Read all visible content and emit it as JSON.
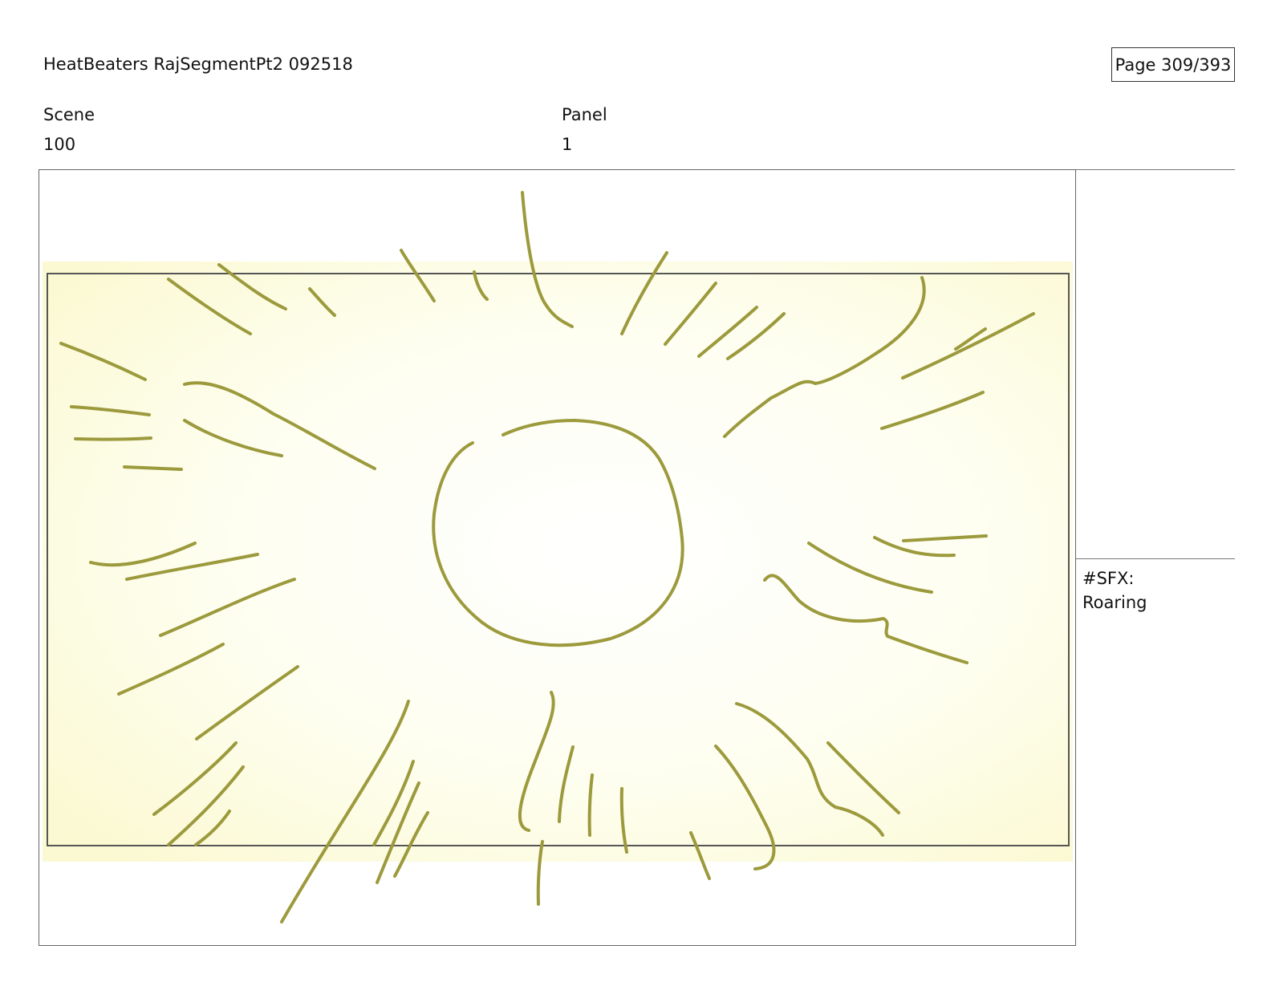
{
  "document": {
    "title": "HeatBeaters RajSegmentPt2 092518",
    "page": "Page 309/393"
  },
  "fields": {
    "scene_label": "Scene",
    "scene_value": "100",
    "panel_label": "Panel",
    "panel_value": "1"
  },
  "panel_notes": {
    "line1": "#SFX:",
    "line2": "Roaring"
  },
  "artwork": {
    "subject": "sun-burst-sketch",
    "stroke_color": "#9c9a3c",
    "glow_color": "#fdfde0",
    "frame_color": "#555555"
  }
}
